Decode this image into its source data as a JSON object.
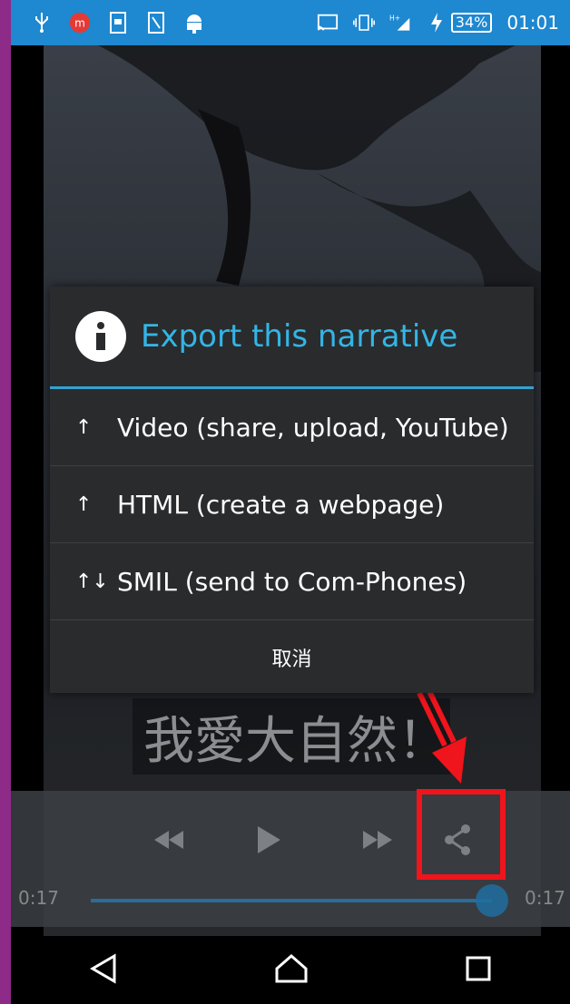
{
  "status_bar": {
    "battery_percent": "34%",
    "time": "01:01"
  },
  "dialog": {
    "title": "Export this narrative",
    "options": [
      {
        "arrow": "↑",
        "label": "Video (share, upload, YouTube)"
      },
      {
        "arrow": "↑",
        "label": "HTML (create a webpage)"
      },
      {
        "arrow": "↑↓",
        "label": "SMIL (send to Com-Phones)"
      }
    ],
    "cancel_label": "取消"
  },
  "player": {
    "caption": "我愛大自然！",
    "time_elapsed": "0:17",
    "time_total": "0:17",
    "progress": 0.95
  },
  "icons": [
    "usb-icon",
    "app-m-icon",
    "screen-record-icon",
    "note-icon",
    "android-icon",
    "cast-icon",
    "vibrate-icon",
    "signal-icon",
    "charging-icon",
    "info-icon",
    "rewind-icon",
    "play-icon",
    "fast-forward-icon",
    "share-icon",
    "back-icon",
    "home-icon",
    "recent-apps-icon"
  ]
}
